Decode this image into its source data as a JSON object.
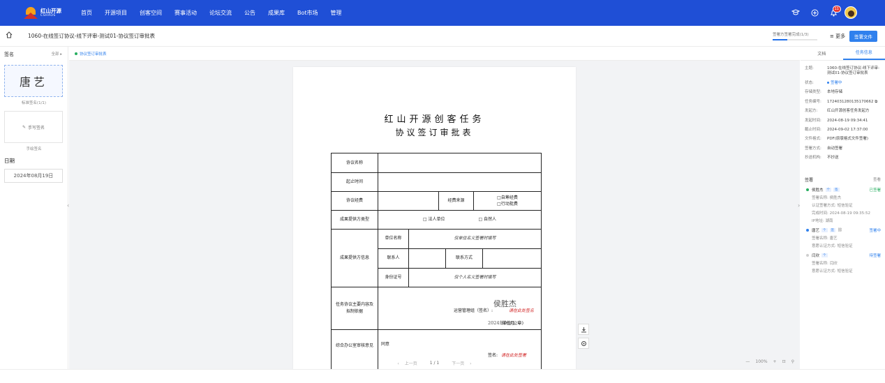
{
  "nav": {
    "logo_title": "红山开源",
    "logo_subtitle": "CSHAOS",
    "items": [
      "首页",
      "开源项目",
      "创客空间",
      "赛事活动",
      "论坛交流",
      "公告",
      "成果库",
      "Bot市场",
      "管理"
    ],
    "badge_count": "11"
  },
  "subbar": {
    "breadcrumb": "1060-在线签订协议-线下评审-测试01-协议签订审批表",
    "progress_label": "签署方签署完成(1/3)",
    "progress_fraction": 0.33,
    "more_label": "更多",
    "sign_button": "签署文件"
  },
  "left": {
    "heading": "签名",
    "all_label": "全部",
    "signature_text": "唐艺",
    "signature_caption": "标准签名(1/1)",
    "handwrite_button": "手写签名",
    "handwrite_caption": "手绘签名",
    "date_heading": "日期",
    "date_value": "2024年08月19日"
  },
  "doc": {
    "tab_label": "协议签订审批表",
    "title_line1": "红山开源创客任务",
    "title_line2": "协议签订审批表",
    "rows": {
      "agreement_name": "协议名称",
      "period": "起止时间",
      "budget": "协议经费",
      "funding_source": "经费来源",
      "source_opt1": "□自筹经费",
      "source_opt2": "□行动批费",
      "provider_type": "成果提供方类型",
      "type_opt1": "□ 法人单位",
      "type_opt2": "□ 自然人",
      "provider_info": "成果提供方信息",
      "unit_name": "单位名称",
      "unit_hint": "仅单位名义签署时填写",
      "contact": "联系人",
      "contact_method": "联系方式",
      "id_number": "身份证号",
      "id_hint": "仅个人名义签署时填写",
      "task_content": "任务协议主要内容及拟制依据",
      "manager_label": "运营管理组（签名）:",
      "manager_sign_hint": "请在此处签名",
      "manager_signature": "侯胜杰",
      "manager_date": "2024年08月",
      "dept_stamp": "单位(公章)",
      "office_opinion": "综合办公室审核意见",
      "agree": "同意",
      "sign_label": "签名:",
      "sign_hint": "请在此处签署"
    },
    "pager": {
      "prev": "上一页",
      "page": "1 / 1",
      "next": "下一页"
    },
    "zoom": {
      "minus": "—",
      "level": "100%",
      "plus": "+"
    }
  },
  "right": {
    "tab_file": "文档",
    "tab_info": "任务信息",
    "info": [
      {
        "k": "主题:",
        "v": "1060-在线签订协议-线下评审-测试01-协议签订审批表"
      },
      {
        "k": "状态:",
        "v": "签署中"
      },
      {
        "k": "存储类型:",
        "v": "本地存储"
      },
      {
        "k": "任务编号:",
        "v": "1724031280135170662"
      },
      {
        "k": "发起方:",
        "v": "红山开源创客任务发起方"
      },
      {
        "k": "发起时间:",
        "v": "2024-08-19 09:34:41"
      },
      {
        "k": "截止时间:",
        "v": "2024-09-02 17:37:00"
      },
      {
        "k": "文件格式:",
        "v": "PDF(原版格式文件签署)"
      },
      {
        "k": "签署方式:",
        "v": "自动签署"
      },
      {
        "k": "抄送机构:",
        "v": "不抄送"
      }
    ],
    "signers_heading": "签署",
    "view_label": "查看",
    "signers": [
      {
        "name": "侯胜杰",
        "status": "已签署",
        "color": "#27ae60",
        "lines": [
          "签署名称: 侯胜杰",
          "认证签署方式: 短信验证",
          "完成时间: 2024-08-19 09:35:52",
          "IP地址: 湖南"
        ]
      },
      {
        "name": "唐艺",
        "status": "签署中",
        "color": "#2f80ed",
        "lines": [
          "签署名称: 唐艺",
          "意愿认证方式: 短信验证"
        ]
      },
      {
        "name": "闫欣",
        "status": "待签署",
        "color": "#999999",
        "lines": [
          "签署名称: 闫欣",
          "意愿认证方式: 短信验证"
        ]
      }
    ]
  }
}
